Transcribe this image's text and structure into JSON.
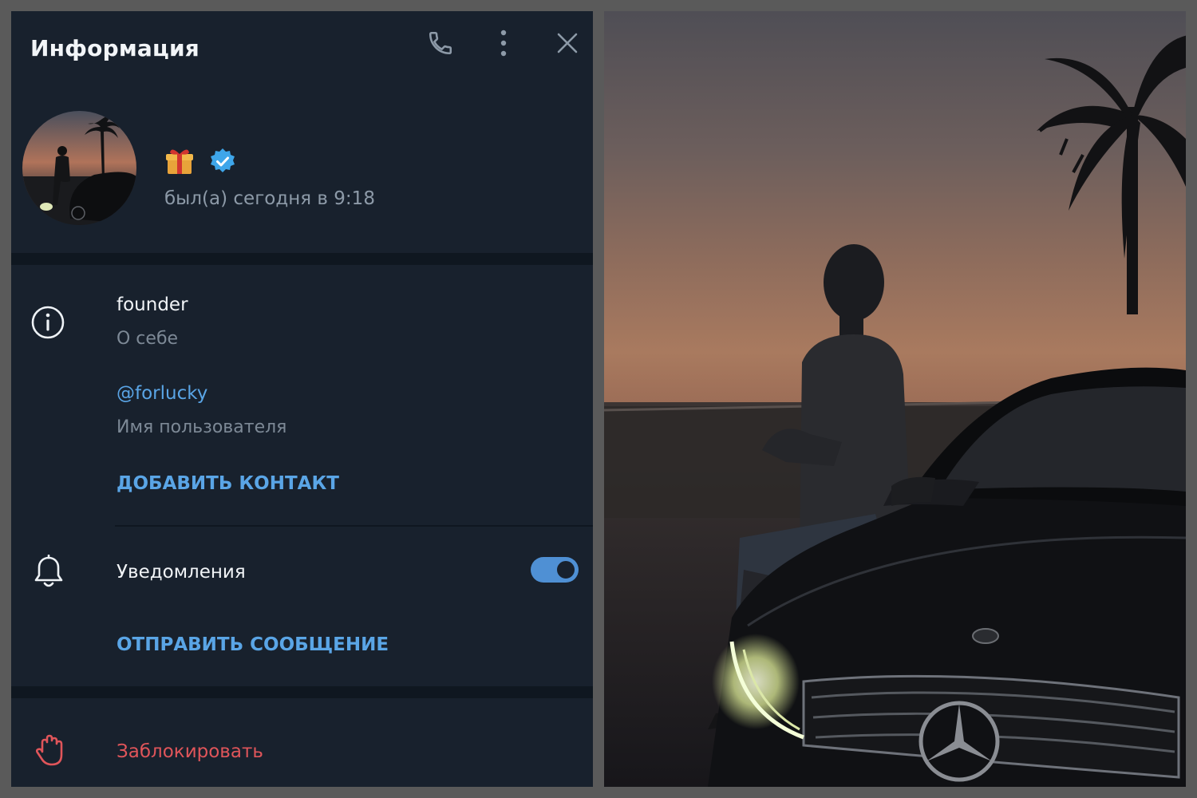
{
  "header": {
    "title": "Информация",
    "icons": [
      "phone-icon",
      "more-vertical-icon",
      "close-icon"
    ]
  },
  "profile": {
    "avatar_icon": "profile-photo-avatar",
    "badges": [
      "gift-emoji",
      "verified-badge-icon"
    ],
    "status": "был(а) сегодня в 9:18"
  },
  "info": {
    "bio_value": "founder",
    "bio_label": "О себе",
    "username_value": "@forlucky",
    "username_label": "Имя пользователя",
    "add_contact": "ДОБАВИТЬ КОНТАКТ"
  },
  "notifications": {
    "label": "Уведомления",
    "enabled": true
  },
  "send_message": "ОТПРАВИТЬ СООБЩЕНИЕ",
  "block": "Заблокировать",
  "colors": {
    "panel_bg": "#18212d",
    "separator": "#0f1720",
    "accent": "#5aa5e6",
    "toggle": "#4f90d4",
    "danger": "#e0555a",
    "secondary_text": "#7d8996",
    "frame": "#5a5a5a"
  },
  "photo": {
    "description_icon": "profile-photo-large"
  }
}
